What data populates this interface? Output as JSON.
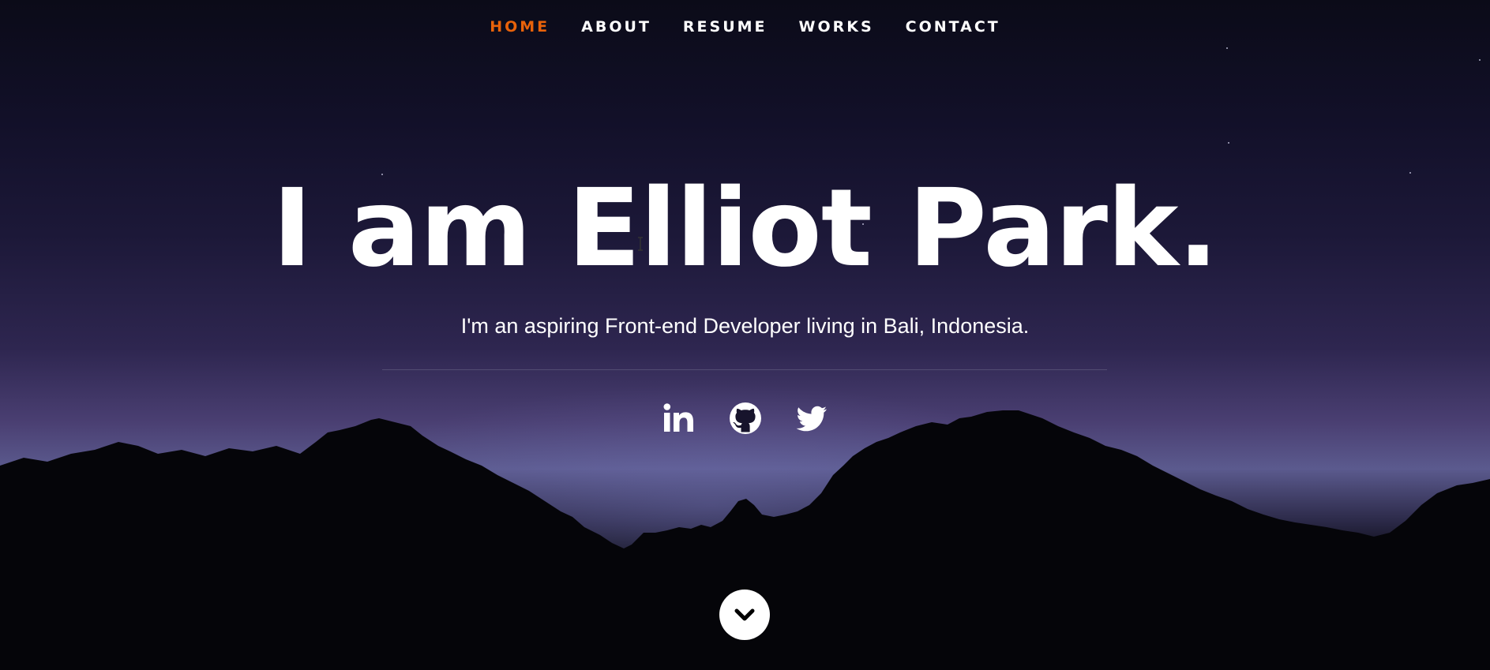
{
  "nav": {
    "items": [
      {
        "label": "HOME",
        "active": true
      },
      {
        "label": "ABOUT",
        "active": false
      },
      {
        "label": "RESUME",
        "active": false
      },
      {
        "label": "WORKS",
        "active": false
      },
      {
        "label": "CONTACT",
        "active": false
      }
    ],
    "active_color": "#e8620a",
    "link_color": "#ffffff"
  },
  "hero": {
    "headline": "I am Elliot Park.",
    "subtitle": "I'm an aspiring Front-end Developer living in Bali, Indonesia."
  },
  "social": [
    {
      "icon": "linkedin-icon"
    },
    {
      "icon": "github-icon"
    },
    {
      "icon": "twitter-icon"
    }
  ],
  "scroll_button": {
    "icon": "chevron-down-icon"
  }
}
